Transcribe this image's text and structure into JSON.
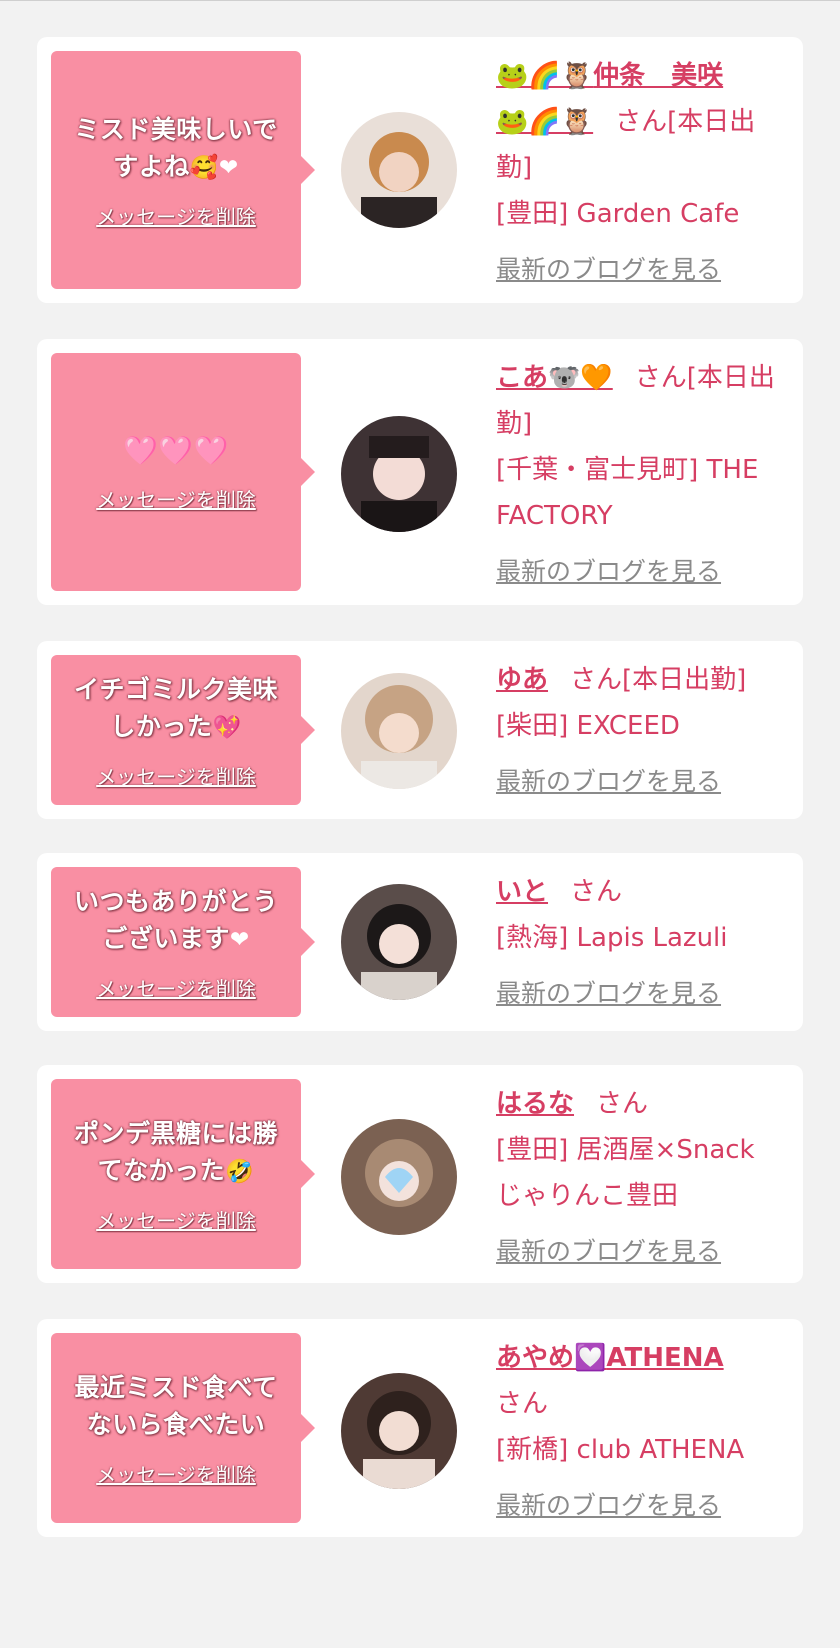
{
  "items": [
    {
      "message": "ミスド美味しいですよね",
      "message_emoji": "🥰❤",
      "delete_label": "メッセージを削除",
      "name_deco": "🐸🌈🦉",
      "name": "仲条　美咲",
      "name_deco2": "🐸🌈🦉",
      "suffix": "さん[本日出勤]",
      "shop": "[豊田] Garden Cafe",
      "blog_label": "最新のブログを見る",
      "avatar_bg": "#e0c8b4"
    },
    {
      "message": "",
      "message_emoji": "🩷🩷🩷",
      "delete_label": "メッセージを削除",
      "name": "こあ",
      "name_emoji": "🐨🧡",
      "suffix": "さん[本日出勤]",
      "shop": "[千葉・富士見町] THE FACTORY",
      "blog_label": "最新のブログを見る",
      "avatar_bg": "#5a4a48"
    },
    {
      "message": "イチゴミルク美味しかった",
      "message_emoji": "💖",
      "delete_label": "メッセージを削除",
      "name": "ゆあ",
      "suffix": "さん[本日出勤]",
      "shop": "[柴田] EXCEED",
      "blog_label": "最新のブログを見る",
      "avatar_bg": "#d9c6bb"
    },
    {
      "message": "いつもありがとうございます",
      "message_emoji": "❤",
      "delete_label": "メッセージを削除",
      "name": "いと",
      "suffix": "さん",
      "shop": "[熱海] Lapis Lazuli",
      "blog_label": "最新のブログを見る",
      "avatar_bg": "#4a4040"
    },
    {
      "message": "ポンデ黒糖には勝てなかった",
      "message_emoji": "🤣",
      "delete_label": "メッセージを削除",
      "name": "はるな",
      "suffix": "さん",
      "shop": "[豊田] 居酒屋×Snack じゃりんこ豊田",
      "blog_label": "最新のブログを見る",
      "avatar_bg": "#8d7565"
    },
    {
      "message": "最近ミスド食べてないら食べたい",
      "message_emoji": "",
      "delete_label": "メッセージを削除",
      "name": "あやめ",
      "name_emoji": "💟",
      "name_after": "ATHENA",
      "suffix": "さん",
      "shop": "[新橋] club ATHENA",
      "blog_label": "最新のブログを見る",
      "avatar_bg": "#6b5048"
    }
  ]
}
